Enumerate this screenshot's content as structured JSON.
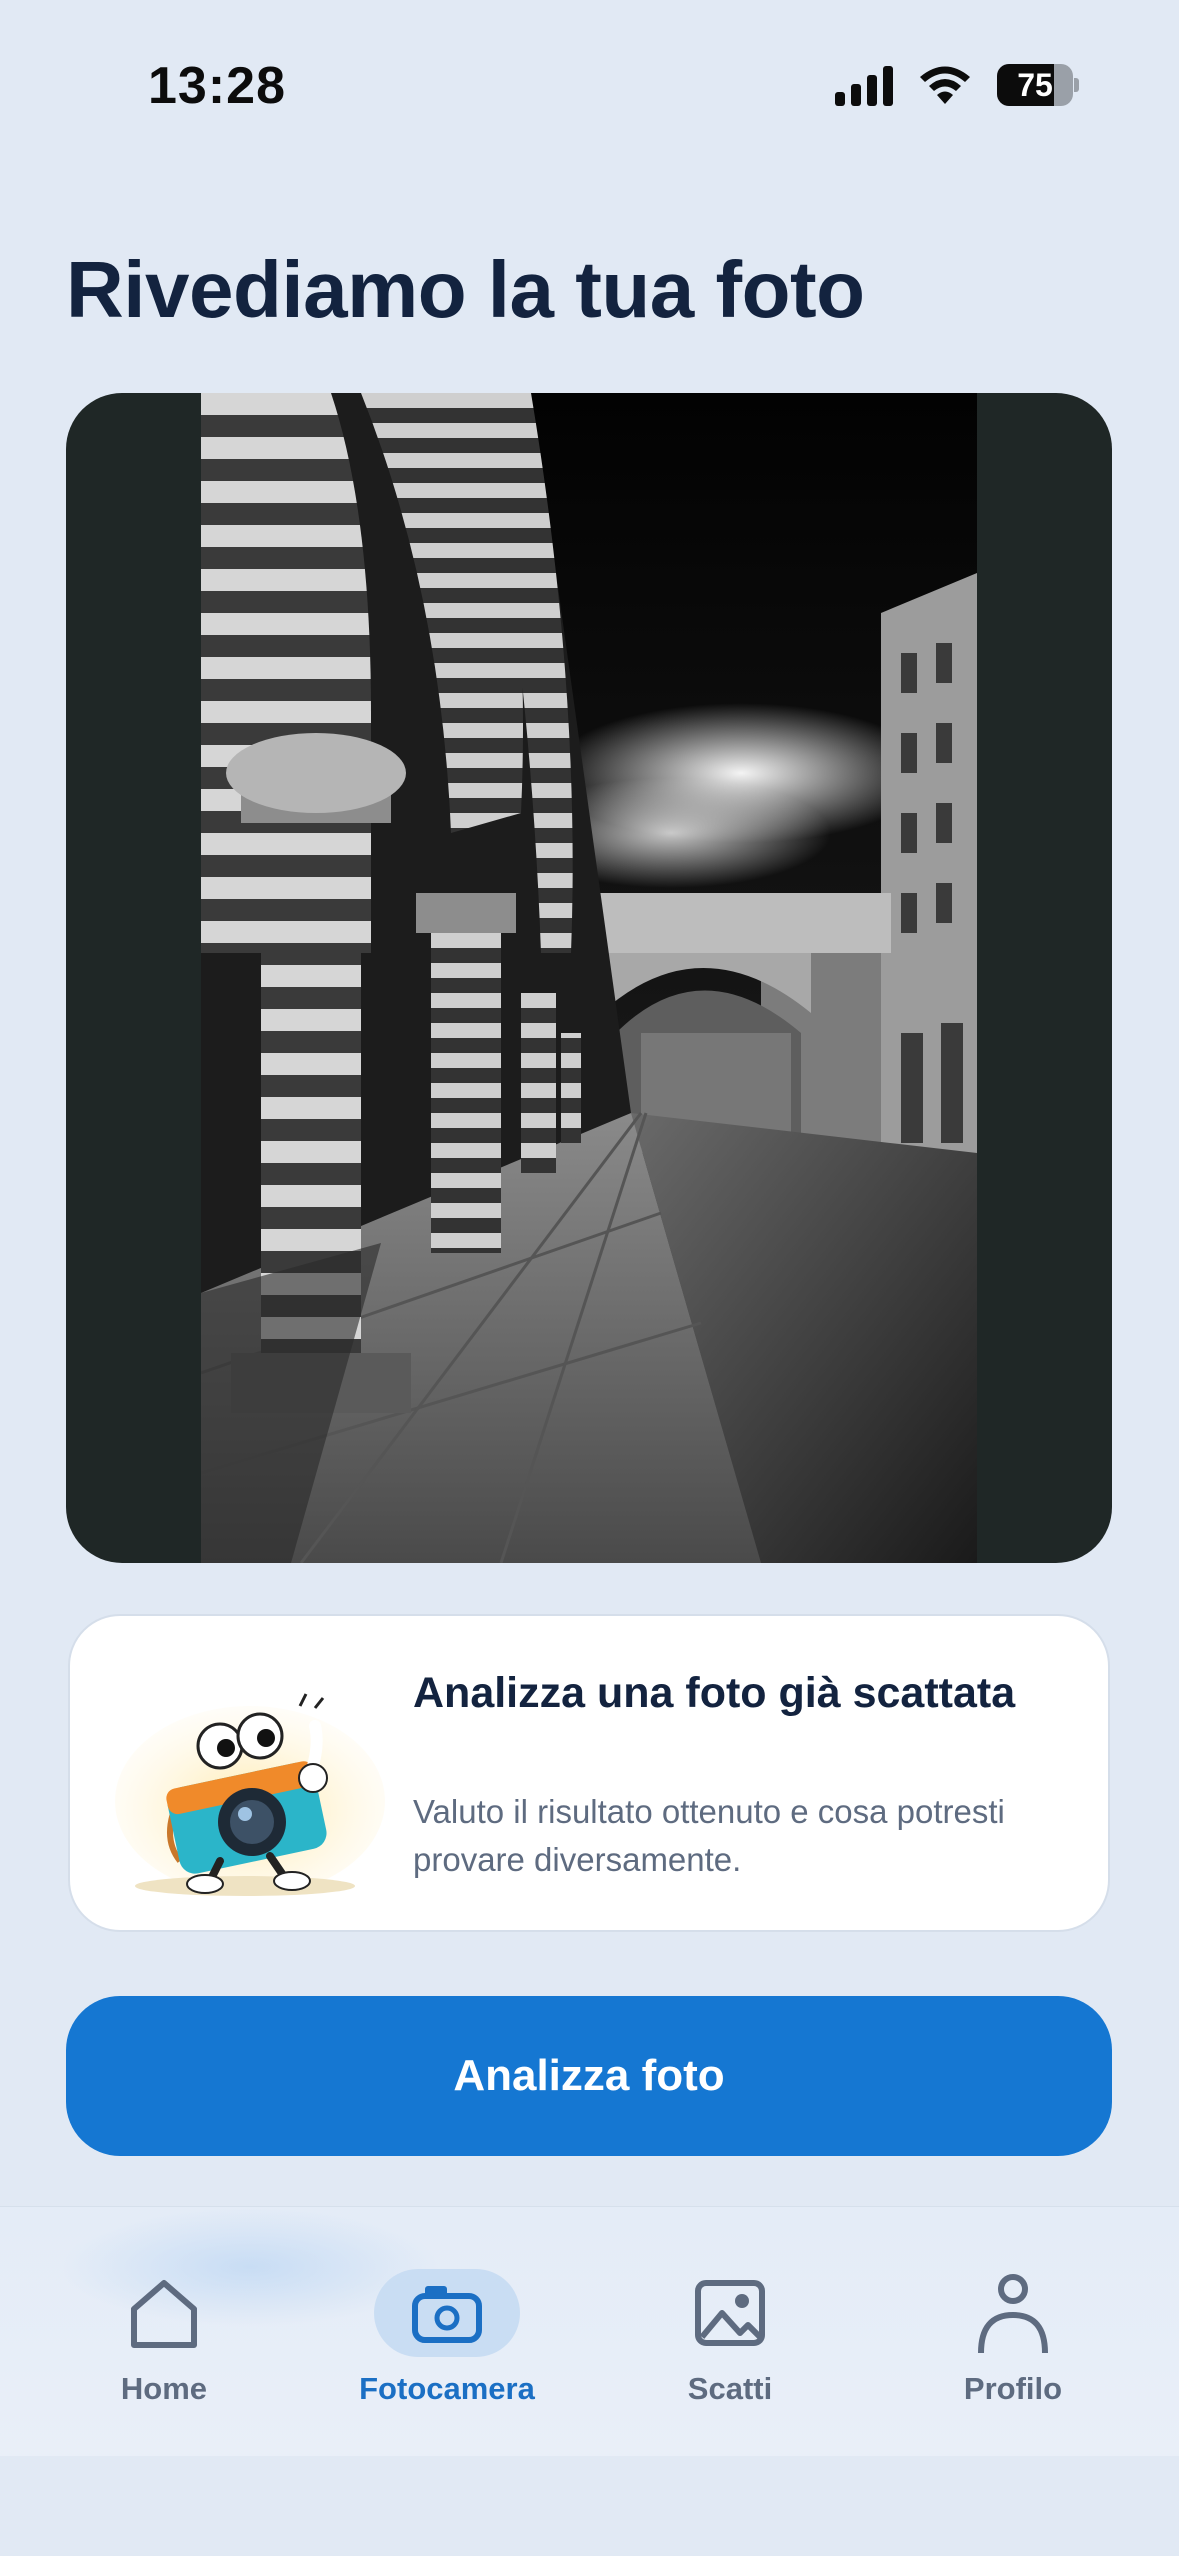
{
  "status_bar": {
    "time": "13:28",
    "battery_level": "75",
    "battery_fraction": 0.75,
    "icons": [
      "signal-icon",
      "wifi-icon",
      "battery-icon"
    ]
  },
  "page": {
    "title": "Rivediamo la tua foto"
  },
  "photo": {
    "description_icon": "street-photo",
    "colors": {
      "card_background": "#1F2726"
    }
  },
  "analysis_card": {
    "title": "Analizza una foto già scattata",
    "description": "Valuto il risultato ottenuto e cosa potresti provare diversamente.",
    "illustration": "camera-mascot-illustration"
  },
  "primary_action": {
    "label": "Analizza foto",
    "color": "#1577D2"
  },
  "tab_bar": {
    "tabs": [
      {
        "label": "Home",
        "icon": "home-icon",
        "active": false
      },
      {
        "label": "Fotocamera",
        "icon": "camera-icon",
        "active": true
      },
      {
        "label": "Scatti",
        "icon": "image-icon",
        "active": false
      },
      {
        "label": "Profilo",
        "icon": "profile-icon",
        "active": false
      }
    ],
    "active_color": "#1B6FC4",
    "inactive_color": "#5E6B80"
  }
}
